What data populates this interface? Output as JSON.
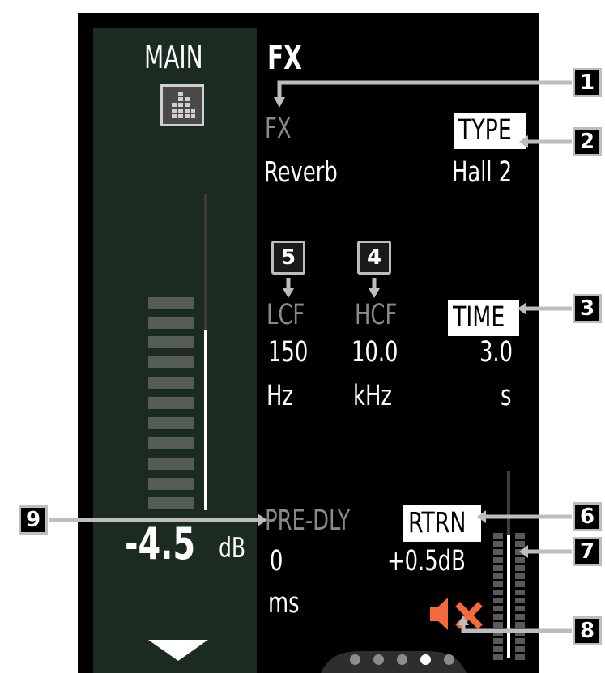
{
  "main": {
    "label": "MAIN",
    "level_value": "-4.5",
    "level_unit": "dB",
    "meter_level_fraction": 0.62
  },
  "fx": {
    "title": "FX",
    "fx_label": "FX",
    "fx_value": "Reverb",
    "type_label": "TYPE",
    "type_value": "Hall 2",
    "lcf_label": "LCF",
    "lcf_value": "150",
    "lcf_unit": "Hz",
    "hcf_label": "HCF",
    "hcf_value": "10.0",
    "hcf_unit": "kHz",
    "time_label": "TIME",
    "time_value": "3.0",
    "time_unit": "s",
    "predly_label": "PRE-DLY",
    "predly_value": "0",
    "predly_unit": "ms",
    "rtrn_label": "RTRN",
    "rtrn_value": "+0.5dB"
  },
  "callouts": [
    "1",
    "2",
    "3",
    "4",
    "5",
    "6",
    "7",
    "8",
    "9"
  ],
  "page_indicator": {
    "pages": 5,
    "active_index": 3
  },
  "colors": {
    "screen": "#000000",
    "main_strip": "#1b2b1f",
    "mute_icon": "#f26a3d",
    "label_gray": "#8a8a8a",
    "callout_border": "#bdbdbd"
  },
  "icons": {
    "main_icon": "channel-grid-icon",
    "mute": "speaker-mute-icon",
    "scroll": "down-triangle-icon"
  }
}
